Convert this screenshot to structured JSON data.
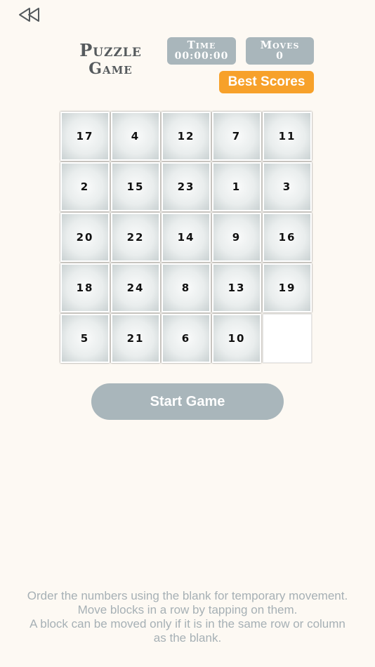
{
  "header": {
    "back_icon": "rewind-icon",
    "title_line1": "Puzzle",
    "title_line2": "Game"
  },
  "stats": {
    "time_label": "Time",
    "time_value": "00:00:00",
    "moves_label": "Moves",
    "moves_value": "0"
  },
  "best_scores_label": "Best Scores",
  "board": {
    "tiles": [
      "17",
      "4",
      "12",
      "7",
      "11",
      "2",
      "15",
      "23",
      "1",
      "3",
      "20",
      "22",
      "14",
      "9",
      "16",
      "18",
      "24",
      "8",
      "13",
      "19",
      "5",
      "21",
      "6",
      "10",
      ""
    ]
  },
  "start_button_label": "Start Game",
  "instructions": {
    "line1": "Order the numbers using the blank for temporary movement.",
    "line2": "Move blocks in a row by tapping on them.",
    "line3": "A block can be moved only if it is in the same row or column",
    "line4": "as the blank."
  },
  "colors": {
    "background": "#fdf9f3",
    "stat_box": "#a9b6bb",
    "best_scores": "#f7a12a",
    "start_button": "#a9b6bb",
    "instructions_text": "#a6b0b5"
  }
}
